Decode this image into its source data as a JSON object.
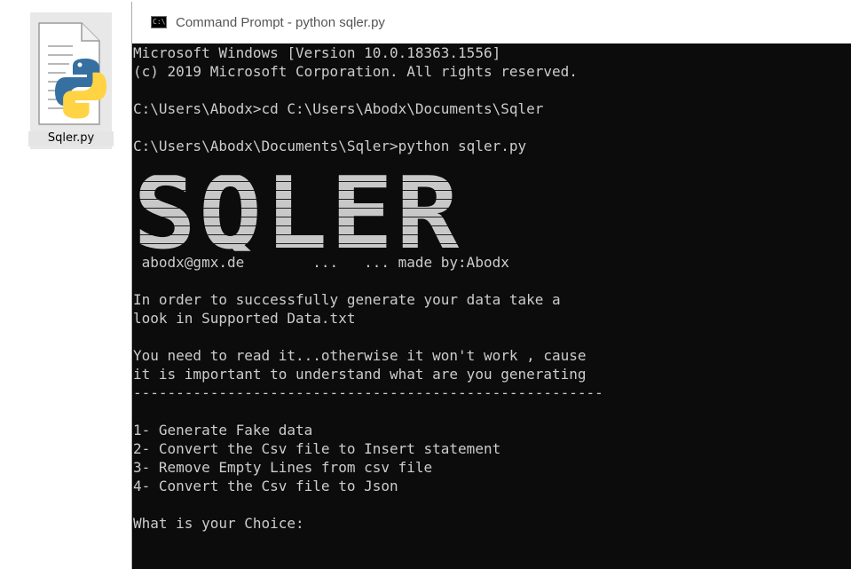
{
  "desktop": {
    "icon_label": "Sqler.py",
    "icon_name": "python-file-icon"
  },
  "window": {
    "title": "Command Prompt - python  sqler.py",
    "app_icon_text": "C:\\"
  },
  "console": {
    "lines": [
      "Microsoft Windows [Version 10.0.18363.1556]",
      "(c) 2019 Microsoft Corporation. All rights reserved.",
      "",
      "C:\\Users\\Abodx>cd C:\\Users\\Abodx\\Documents\\Sqler",
      "",
      "C:\\Users\\Abodx\\Documents\\Sqler>python sqler.py"
    ],
    "banner": "SQLER",
    "credit_line": " abodx@gmx.de        ...   ... made by:Abodx",
    "body_lines": [
      "In order to successfully generate your data take a",
      "look in Supported Data.txt",
      "",
      "You need to read it...otherwise it won't work , cause",
      "it is important to understand what are you generating",
      "-------------------------------------------------------",
      "",
      "1- Generate Fake data",
      "2- Convert the Csv file to Insert statement",
      "3- Remove Empty Lines from csv file",
      "4- Convert the Csv file to Json",
      "",
      "What is your Choice:"
    ]
  },
  "colors": {
    "console_bg": "#0c0c0c",
    "console_fg": "#cccccc",
    "python_blue": "#3670a0",
    "python_yellow": "#ffd343"
  }
}
